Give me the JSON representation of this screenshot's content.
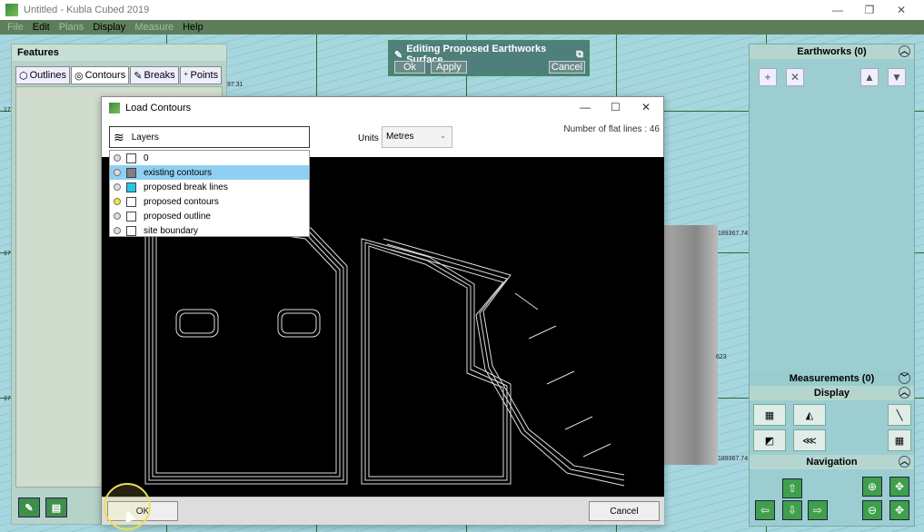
{
  "window": {
    "title": "Untitled - Kubla Cubed 2019",
    "minimize": "—",
    "restore": "❐",
    "close": "✕"
  },
  "menu": [
    {
      "label": "File",
      "enabled": false
    },
    {
      "label": "Edit",
      "enabled": true
    },
    {
      "label": "Plans",
      "enabled": false
    },
    {
      "label": "Display",
      "enabled": true
    },
    {
      "label": "Measure",
      "enabled": false
    },
    {
      "label": "Help",
      "enabled": true
    }
  ],
  "features": {
    "title": "Features",
    "tabs": [
      {
        "label": "Outlines",
        "icon": "outline-icon"
      },
      {
        "label": "Contours",
        "icon": "contour-icon"
      },
      {
        "label": "Breaks",
        "icon": "breaks-icon"
      },
      {
        "label": "Points",
        "icon": "points-icon"
      }
    ]
  },
  "edit_panel": {
    "title": "Editing Proposed Earthworks Surface...",
    "ok": "Ok",
    "apply": "Apply",
    "cancel": "Cancel"
  },
  "right_panel": {
    "earthworks": "Earthworks (0)",
    "measurements": "Measurements (0)",
    "display": "Display",
    "navigation": "Navigation"
  },
  "map_labels": {
    "coord1": "189367.74",
    "coord2": "189367.74",
    "n1": "623",
    "left1": "17",
    "left2": "17",
    "left3": "17",
    "top": "97.31"
  },
  "dialog": {
    "title": "Load Contours",
    "minimize": "—",
    "maximize": "☐",
    "close": "✕",
    "flat_lines": "Number of flat lines : 46",
    "units_label": "Units",
    "units_value": "Metres",
    "layers_label": "Layers",
    "layers": [
      {
        "name": "0",
        "color": "#ffffff",
        "dot": "#dddddd",
        "selected": false
      },
      {
        "name": "existing contours",
        "color": "#808080",
        "dot": "#dddddd",
        "selected": true
      },
      {
        "name": "proposed break lines",
        "color": "#22c8e8",
        "dot": "#dddddd",
        "selected": false
      },
      {
        "name": "proposed contours",
        "color": "#ffffff",
        "dot": "#f2e23a",
        "selected": false
      },
      {
        "name": "proposed outline",
        "color": "#ffffff",
        "dot": "#dddddd",
        "selected": false
      },
      {
        "name": "site boundary",
        "color": "#ffffff",
        "dot": "#dddddd",
        "selected": false
      }
    ],
    "ok": "OK",
    "cancel": "Cancel"
  }
}
